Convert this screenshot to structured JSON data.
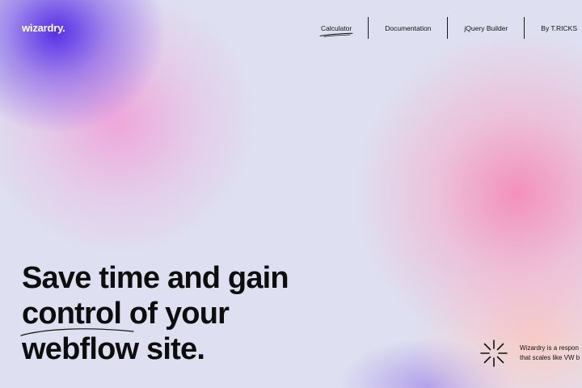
{
  "brand": {
    "logo": "wizardry."
  },
  "nav": {
    "items": [
      {
        "label": "Calculator",
        "active": true
      },
      {
        "label": "Documentation"
      },
      {
        "label": "jQuery Builder"
      },
      {
        "label": "By T.RICKS"
      }
    ]
  },
  "hero": {
    "line1": "Save time and gain",
    "line2_word": "control",
    "line2_rest": " of your",
    "line3": "webflow site."
  },
  "footer_note": {
    "icon": "asterisk-icon",
    "line1": "Wizardry is a respon",
    "line2": "that scales like VW b"
  },
  "colors": {
    "text": "#0d0d0d",
    "logo": "#ffffff",
    "blob_violet": "#5630e6",
    "blob_pink": "#f58cb9",
    "background": "#dedff0"
  }
}
